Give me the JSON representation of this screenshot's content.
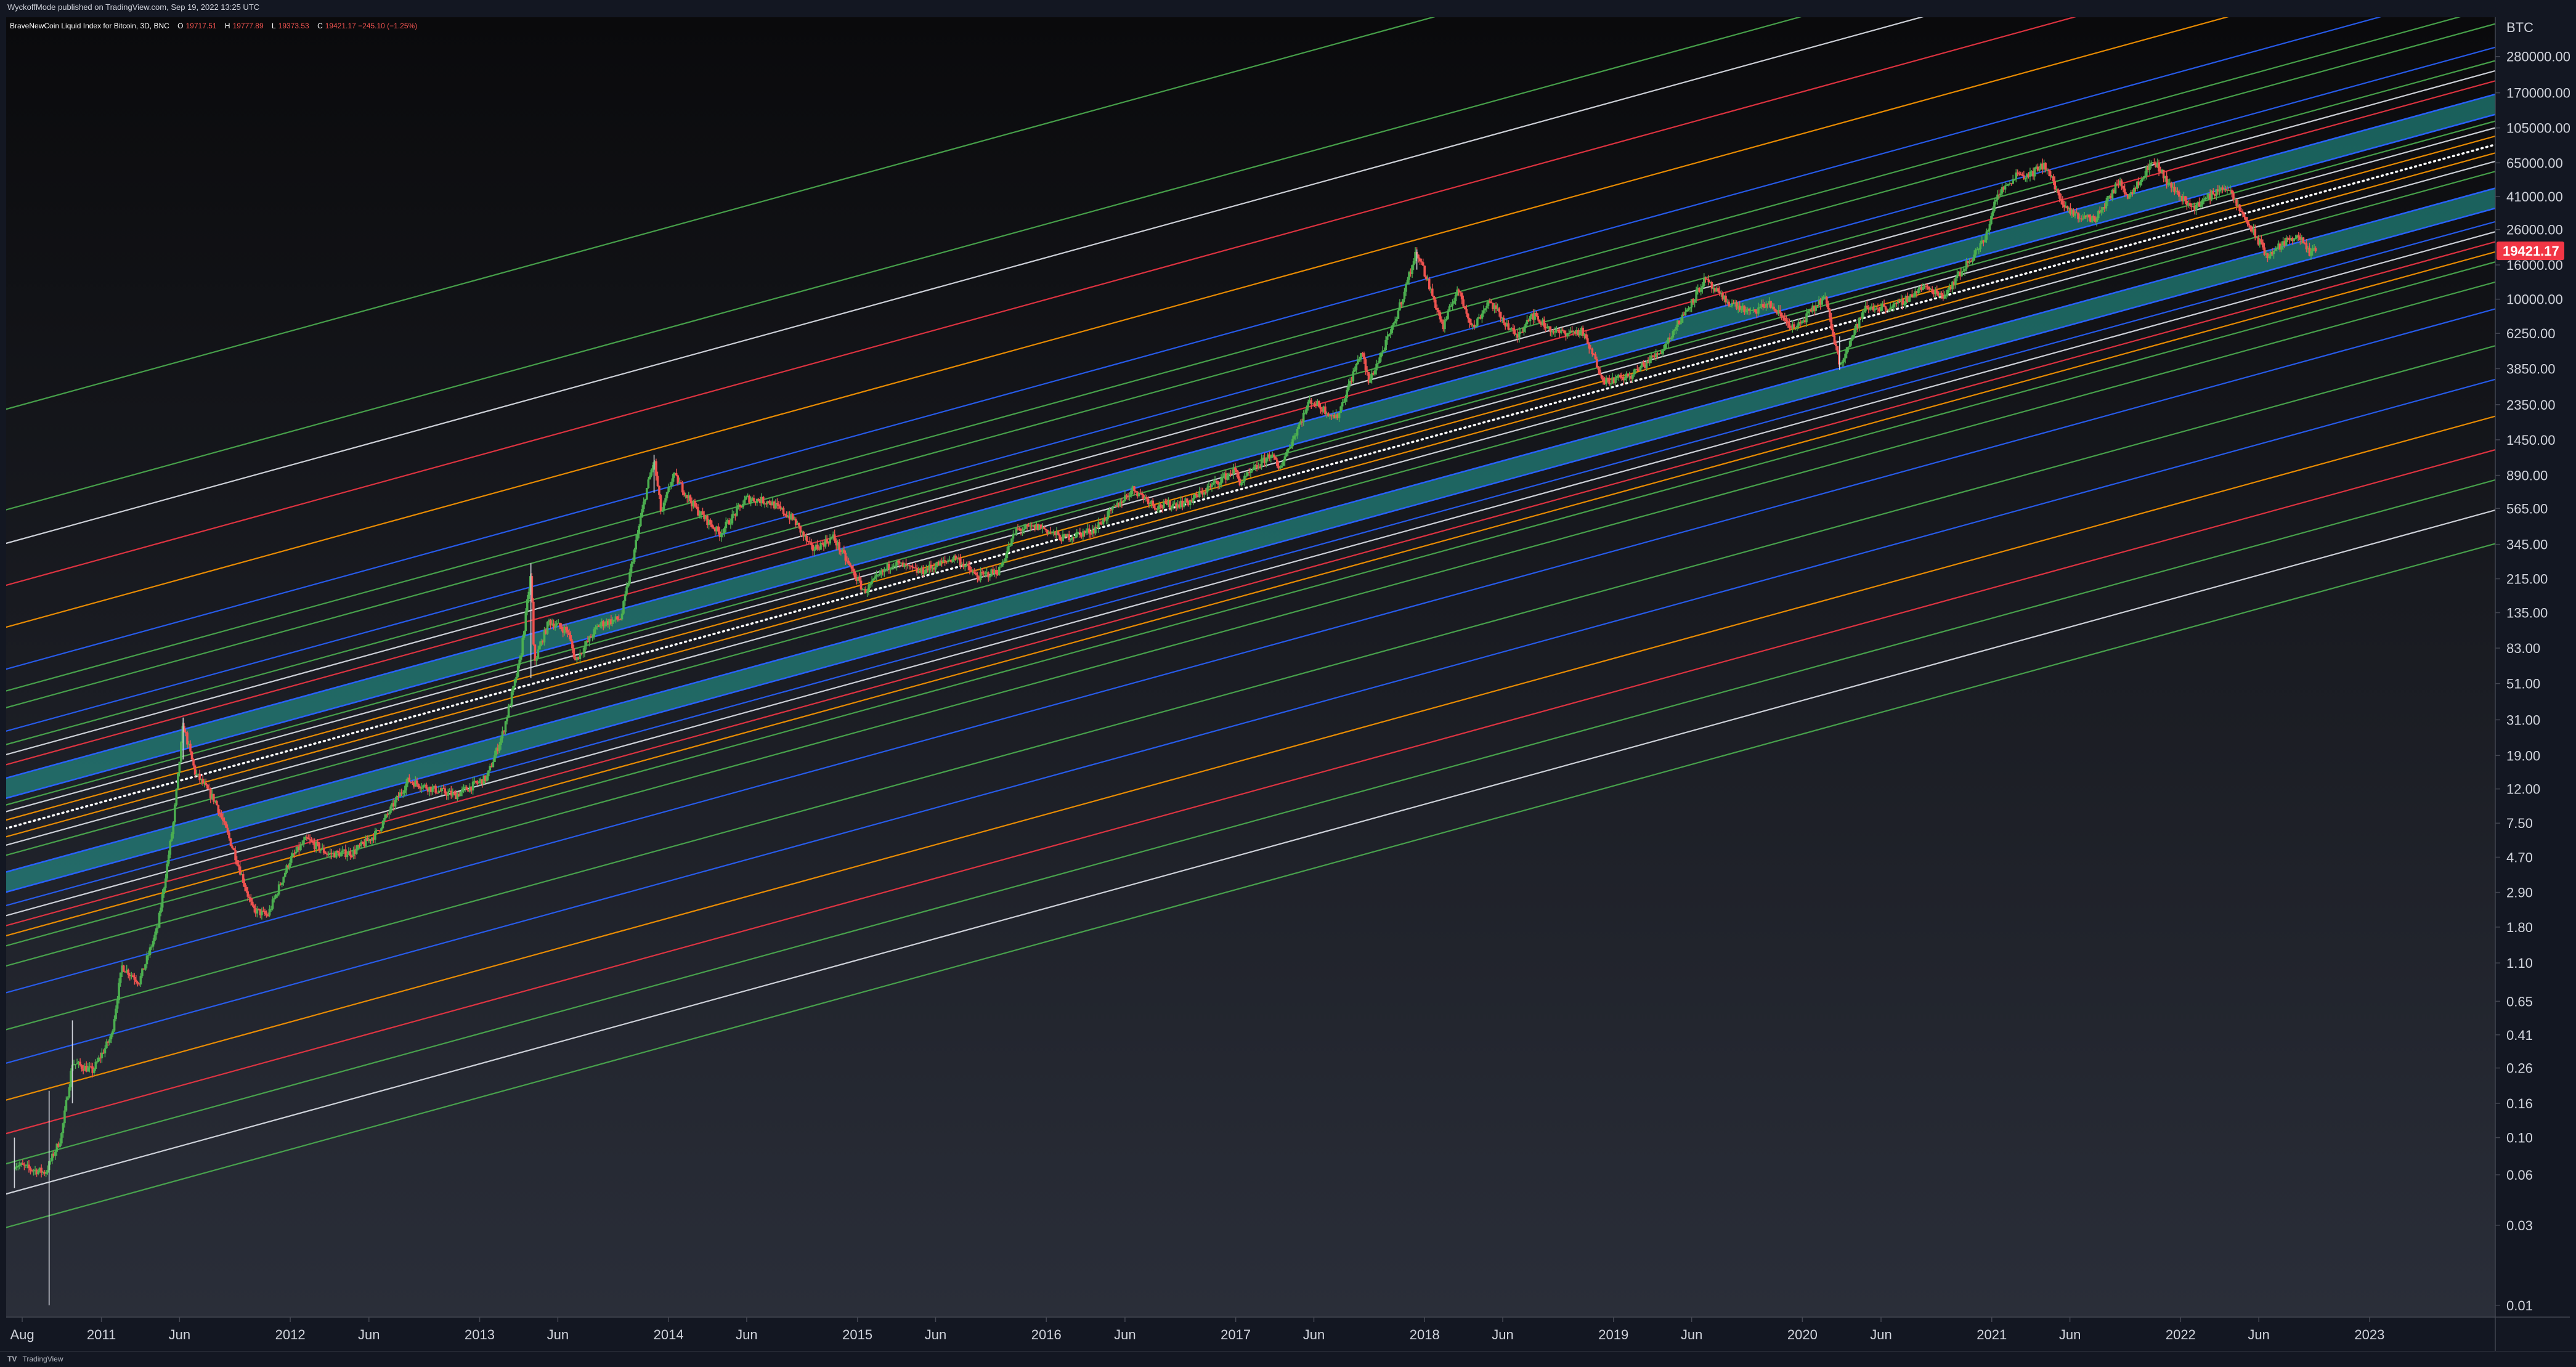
{
  "header": {
    "publish_line": "WyckoffMode published on TradingView.com, Sep 19, 2022 13:25 UTC"
  },
  "legend": {
    "symbol": "BraveNewCoin Liquid Index for Bitcoin, 3D, BNC",
    "o_label": "O",
    "o_value": "19717.51",
    "h_label": "H",
    "h_value": "19777.89",
    "l_label": "L",
    "l_value": "19373.53",
    "c_label": "C",
    "c_value": "19421.17 −245.10 (−1.25%)"
  },
  "footer": {
    "logo_text": "TV",
    "brand": "TradingView"
  },
  "colors": {
    "background_top": "#0a0a0c",
    "background_bottom": "#2a2e39",
    "green": "#4caf50",
    "white": "#e0e3eb",
    "red": "#f23645",
    "orange": "#ff9800",
    "blue": "#2962ff",
    "teal_band": "#26a69a",
    "candle_up": "#4caf50",
    "candle_down": "#ef5350",
    "price_tag": "#f23645"
  },
  "chart_data": {
    "type": "candlestick-log",
    "y_axis_unit": "BTC",
    "y_scale": "log",
    "ylim": [
      0.0085,
      480000
    ],
    "xlim": [
      "2010-07-01",
      "2023-09-01"
    ],
    "y_ticks": [
      "280000.00",
      "170000.00",
      "105000.00",
      "65000.00",
      "41000.00",
      "26000.00",
      "16000.00",
      "10000.00",
      "6250.00",
      "3850.00",
      "2350.00",
      "1450.00",
      "890.00",
      "565.00",
      "345.00",
      "215.00",
      "135.00",
      "83.00",
      "51.00",
      "31.00",
      "19.00",
      "12.00",
      "7.50",
      "4.70",
      "2.90",
      "1.80",
      "1.10",
      "0.65",
      "0.41",
      "0.26",
      "0.16",
      "0.10",
      "0.06",
      "0.03",
      "0.01"
    ],
    "x_ticks": [
      {
        "label": "Aug",
        "date": "2010-08-01"
      },
      {
        "label": "2011",
        "date": "2011-01-01"
      },
      {
        "label": "Jun",
        "date": "2011-06-01"
      },
      {
        "label": "2012",
        "date": "2012-01-01"
      },
      {
        "label": "Jun",
        "date": "2012-06-01"
      },
      {
        "label": "2013",
        "date": "2013-01-01"
      },
      {
        "label": "Jun",
        "date": "2013-06-01"
      },
      {
        "label": "2014",
        "date": "2014-01-01"
      },
      {
        "label": "Jun",
        "date": "2014-06-01"
      },
      {
        "label": "2015",
        "date": "2015-01-01"
      },
      {
        "label": "Jun",
        "date": "2015-06-01"
      },
      {
        "label": "2016",
        "date": "2016-01-01"
      },
      {
        "label": "Jun",
        "date": "2016-06-01"
      },
      {
        "label": "2017",
        "date": "2017-01-01"
      },
      {
        "label": "Jun",
        "date": "2017-06-01"
      },
      {
        "label": "2018",
        "date": "2018-01-01"
      },
      {
        "label": "Jun",
        "date": "2018-06-01"
      },
      {
        "label": "2019",
        "date": "2019-01-01"
      },
      {
        "label": "Jun",
        "date": "2019-06-01"
      },
      {
        "label": "2020",
        "date": "2020-01-01"
      },
      {
        "label": "Jun",
        "date": "2020-06-01"
      },
      {
        "label": "2021",
        "date": "2021-01-01"
      },
      {
        "label": "Jun",
        "date": "2021-06-01"
      },
      {
        "label": "2022",
        "date": "2022-01-01"
      },
      {
        "label": "Jun",
        "date": "2022-06-01"
      },
      {
        "label": "2023",
        "date": "2023-01-01"
      }
    ],
    "last_price": "19421.17",
    "last_price_value": 19421.17,
    "price_path": [
      [
        "2010-07-18",
        0.07
      ],
      [
        "2010-08-15",
        0.065
      ],
      [
        "2010-09-15",
        0.062
      ],
      [
        "2010-10-15",
        0.1
      ],
      [
        "2010-11-06",
        0.28
      ],
      [
        "2010-12-15",
        0.25
      ],
      [
        "2011-01-20",
        0.4
      ],
      [
        "2011-02-10",
        1.05
      ],
      [
        "2011-03-15",
        0.85
      ],
      [
        "2011-04-20",
        1.8
      ],
      [
        "2011-05-20",
        7.5
      ],
      [
        "2011-06-08",
        29.0
      ],
      [
        "2011-07-01",
        15.0
      ],
      [
        "2011-08-10",
        10.0
      ],
      [
        "2011-09-15",
        5.0
      ],
      [
        "2011-10-20",
        2.3
      ],
      [
        "2011-11-18",
        2.1
      ],
      [
        "2011-12-31",
        4.5
      ],
      [
        "2012-02-01",
        6.0
      ],
      [
        "2012-03-15",
        4.9
      ],
      [
        "2012-05-01",
        5.0
      ],
      [
        "2012-06-15",
        6.5
      ],
      [
        "2012-08-16",
        13.5
      ],
      [
        "2012-10-01",
        12.0
      ],
      [
        "2012-11-15",
        11.0
      ],
      [
        "2013-01-15",
        14.0
      ],
      [
        "2013-02-15",
        26.0
      ],
      [
        "2013-03-20",
        70.0
      ],
      [
        "2013-04-10",
        230.0
      ],
      [
        "2013-04-16",
        68.0
      ],
      [
        "2013-05-15",
        120.0
      ],
      [
        "2013-06-20",
        105.0
      ],
      [
        "2013-07-05",
        70.0
      ],
      [
        "2013-08-20",
        115.0
      ],
      [
        "2013-10-01",
        125.0
      ],
      [
        "2013-11-18",
        700.0
      ],
      [
        "2013-12-04",
        1100.0
      ],
      [
        "2013-12-18",
        520.0
      ],
      [
        "2014-01-10",
        900.0
      ],
      [
        "2014-02-25",
        550.0
      ],
      [
        "2014-04-10",
        400.0
      ],
      [
        "2014-06-01",
        650.0
      ],
      [
        "2014-07-15",
        620.0
      ],
      [
        "2014-09-01",
        480.0
      ],
      [
        "2014-10-05",
        320.0
      ],
      [
        "2014-11-15",
        380.0
      ],
      [
        "2015-01-14",
        180.0
      ],
      [
        "2015-03-10",
        270.0
      ],
      [
        "2015-05-01",
        235.0
      ],
      [
        "2015-07-10",
        290.0
      ],
      [
        "2015-08-20",
        220.0
      ],
      [
        "2015-10-01",
        240.0
      ],
      [
        "2015-11-04",
        420.0
      ],
      [
        "2015-12-20",
        440.0
      ],
      [
        "2016-02-01",
        375.0
      ],
      [
        "2016-04-01",
        420.0
      ],
      [
        "2016-06-17",
        740.0
      ],
      [
        "2016-08-01",
        580.0
      ],
      [
        "2016-10-01",
        615.0
      ],
      [
        "2016-12-30",
        960.0
      ],
      [
        "2017-01-10",
        800.0
      ],
      [
        "2017-03-10",
        1200.0
      ],
      [
        "2017-03-25",
        960.0
      ],
      [
        "2017-05-25",
        2500.0
      ],
      [
        "2017-07-15",
        1950.0
      ],
      [
        "2017-09-01",
        4900.0
      ],
      [
        "2017-09-15",
        3200.0
      ],
      [
        "2017-11-01",
        6800.0
      ],
      [
        "2017-12-17",
        19500.0
      ],
      [
        "2018-02-06",
        6800.0
      ],
      [
        "2018-03-05",
        11500.0
      ],
      [
        "2018-04-05",
        6700.0
      ],
      [
        "2018-05-05",
        9800.0
      ],
      [
        "2018-06-28",
        5900.0
      ],
      [
        "2018-07-25",
        8200.0
      ],
      [
        "2018-09-10",
        6300.0
      ],
      [
        "2018-11-01",
        6400.0
      ],
      [
        "2018-12-15",
        3250.0
      ],
      [
        "2019-02-01",
        3450.0
      ],
      [
        "2019-04-05",
        5000.0
      ],
      [
        "2019-06-26",
        13000.0
      ],
      [
        "2019-08-01",
        10000.0
      ],
      [
        "2019-09-25",
        8200.0
      ],
      [
        "2019-10-26",
        9500.0
      ],
      [
        "2019-12-18",
        6600.0
      ],
      [
        "2020-02-13",
        10400.0
      ],
      [
        "2020-03-13",
        4100.0
      ],
      [
        "2020-05-01",
        8800.0
      ],
      [
        "2020-07-01",
        9100.0
      ],
      [
        "2020-08-20",
        11800.0
      ],
      [
        "2020-10-01",
        10600.0
      ],
      [
        "2020-12-20",
        23000.0
      ],
      [
        "2021-01-08",
        40000.0
      ],
      [
        "2021-02-20",
        57000.0
      ],
      [
        "2021-03-10",
        54000.0
      ],
      [
        "2021-04-14",
        63500.0
      ],
      [
        "2021-05-23",
        34000.0
      ],
      [
        "2021-06-22",
        31000.0
      ],
      [
        "2021-07-20",
        30000.0
      ],
      [
        "2021-09-06",
        51000.0
      ],
      [
        "2021-09-21",
        41000.0
      ],
      [
        "2021-11-10",
        67500.0
      ],
      [
        "2021-12-10",
        48000.0
      ],
      [
        "2022-01-24",
        35000.0
      ],
      [
        "2022-03-28",
        47500.0
      ],
      [
        "2022-05-12",
        28000.0
      ],
      [
        "2022-06-18",
        18000.0
      ],
      [
        "2022-07-10",
        20500.0
      ],
      [
        "2022-08-14",
        24500.0
      ],
      [
        "2022-09-06",
        18700.0
      ],
      [
        "2022-09-19",
        19421.17
      ]
    ],
    "wicks": [
      [
        "2010-07-17",
        0.05,
        0.1
      ],
      [
        "2010-09-22",
        0.01,
        0.19
      ],
      [
        "2010-11-06",
        0.16,
        0.5
      ],
      [
        "2011-06-08",
        18.0,
        32.0
      ],
      [
        "2013-04-10",
        55.0,
        266.0
      ],
      [
        "2013-12-04",
        700.0,
        1180.0
      ],
      [
        "2017-12-17",
        15000.0,
        19800.0
      ],
      [
        "2020-03-13",
        3800.0,
        6000.0
      ]
    ],
    "fan": {
      "note": "log-linear channel; level = center * 10^(offset_decades)",
      "center_ref": [
        [
          "2011-01-01",
          10.0
        ],
        [
          "2023-01-01",
          52000.0
        ]
      ],
      "teal_bands": [
        [
          0.18,
          0.3
        ],
        [
          -0.38,
          -0.26
        ]
      ],
      "dotted_center_offset": 0.0,
      "lines": [
        {
          "o": 0.05,
          "c": "orange"
        },
        {
          "o": 0.1,
          "c": "white"
        },
        {
          "o": 0.14,
          "c": "green"
        },
        {
          "o": 0.38,
          "c": "red"
        },
        {
          "o": 0.44,
          "c": "white"
        },
        {
          "o": 0.5,
          "c": "green"
        },
        {
          "o": 0.58,
          "c": "blue"
        },
        {
          "o": 0.72,
          "c": "green"
        },
        {
          "o": 0.82,
          "c": "green"
        },
        {
          "o": 0.95,
          "c": "blue"
        },
        {
          "o": 1.2,
          "c": "orange"
        },
        {
          "o": 1.45,
          "c": "red"
        },
        {
          "o": 1.7,
          "c": "white"
        },
        {
          "o": 1.9,
          "c": "green"
        },
        {
          "o": 2.5,
          "c": "green"
        },
        {
          "o": -0.05,
          "c": "orange"
        },
        {
          "o": -0.1,
          "c": "white"
        },
        {
          "o": -0.16,
          "c": "green"
        },
        {
          "o": -0.46,
          "c": "blue"
        },
        {
          "o": -0.52,
          "c": "white"
        },
        {
          "o": -0.58,
          "c": "red"
        },
        {
          "o": -0.64,
          "c": "orange"
        },
        {
          "o": -0.7,
          "c": "green"
        },
        {
          "o": -0.82,
          "c": "green"
        },
        {
          "o": -0.98,
          "c": "blue"
        },
        {
          "o": -1.2,
          "c": "green"
        },
        {
          "o": -1.4,
          "c": "blue"
        },
        {
          "o": -1.62,
          "c": "orange"
        },
        {
          "o": -1.82,
          "c": "red"
        },
        {
          "o": -2.0,
          "c": "green"
        },
        {
          "o": -2.18,
          "c": "white"
        },
        {
          "o": -2.38,
          "c": "green"
        }
      ]
    }
  }
}
